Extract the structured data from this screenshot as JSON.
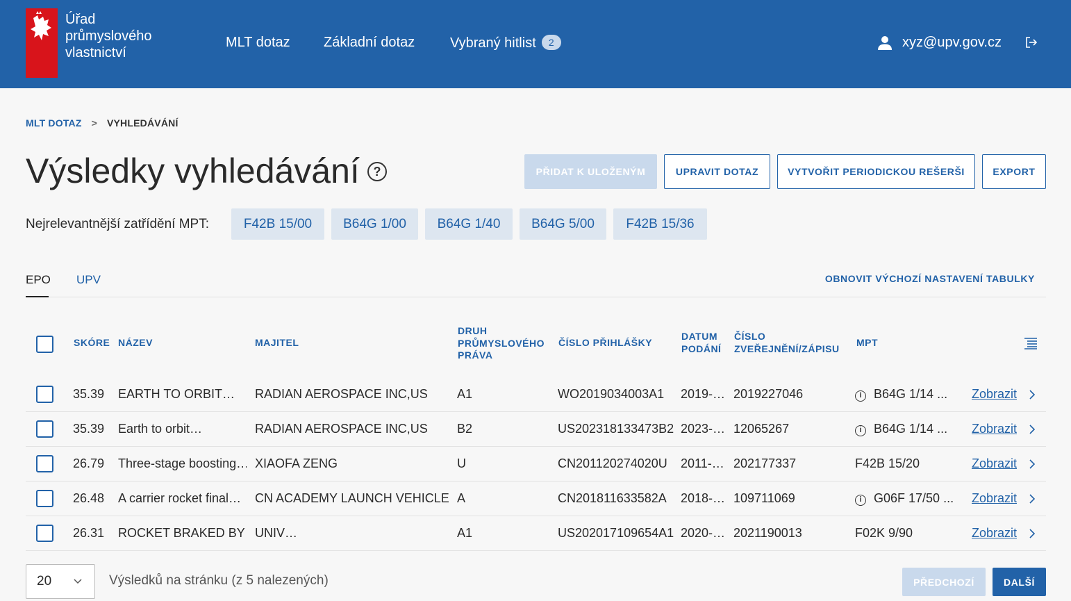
{
  "header": {
    "logo_lines": [
      "Úřad",
      "průmyslového",
      "vlastnictví"
    ],
    "nav": [
      {
        "label": "MLT dotaz"
      },
      {
        "label": "Základní dotaz"
      },
      {
        "label": "Vybraný hitlist",
        "badge": "2"
      }
    ],
    "user_email": "xyz@upv.gov.cz"
  },
  "breadcrumb": {
    "parent": "MLT DOTAZ",
    "separator": ">",
    "current": "VYHLEDÁVÁNÍ"
  },
  "page_title": "Výsledky vyhledávání",
  "help_symbol": "?",
  "actions": {
    "add_saved": "PŘIDAT K ULOŽENÝM",
    "edit_query": "UPRAVIT DOTAZ",
    "create_periodic": "VYTVOŘIT PERIODICKOU REŠERŠI",
    "export": "EXPORT"
  },
  "mpt": {
    "label": "Nejrelevantnější zatřídění MPT:",
    "chips": [
      "F42B 15/00",
      "B64G 1/00",
      "B64G 1/40",
      "B64G 5/00",
      "F42B 15/36"
    ]
  },
  "tabs": {
    "epo": "EPO",
    "upv": "UPV",
    "reset": "OBNOVIT VÝCHOZÍ NASTAVENÍ TABULKY"
  },
  "table": {
    "headers": {
      "score": "SKÓRE",
      "name": "NÁZEV",
      "owner": "MAJITEL",
      "right_type": [
        "DRUH",
        "PRŮMYSLOVÉHO",
        "PRÁVA"
      ],
      "app_number": "ČÍSLO PŘIHLÁŠKY",
      "filing_date": [
        "DATUM",
        "PODÁNÍ"
      ],
      "pub_number": [
        "ČÍSLO",
        "ZVEŘEJNĚNÍ/ZÁPISU"
      ],
      "mpt": "MPT"
    },
    "rows": [
      {
        "score": "35.39",
        "name": "EARTH TO ORBIT…",
        "owner": "RADIAN AEROSPACE INC,US",
        "type": "A1",
        "app": "WO2019034003A1",
        "date": "2019-…",
        "pub": "2019227046",
        "mpt": "B64G 1/14 ...",
        "info": true,
        "action": "Zobrazit"
      },
      {
        "score": "35.39",
        "name": "Earth to orbit…",
        "owner": "RADIAN AEROSPACE INC,US",
        "type": "B2",
        "app": "US202318133473B2",
        "date": "2023-…",
        "pub": "12065267",
        "mpt": "B64G 1/14 ...",
        "info": true,
        "action": "Zobrazit"
      },
      {
        "score": "26.79",
        "name": "Three-stage boosting…",
        "owner": "XIAOFA ZENG",
        "type": "U",
        "app": "CN201120274020U",
        "date": "2011-…",
        "pub": "202177337",
        "mpt": "F42B 15/20",
        "info": false,
        "action": "Zobrazit"
      },
      {
        "score": "26.48",
        "name": "A carrier rocket final…",
        "owner": "CN ACADEMY LAUNCH VEHICLE…",
        "type": "A",
        "app": "CN201811633582A",
        "date": "2018-…",
        "pub": "109711069",
        "mpt": "G06F 17/50 ...",
        "info": true,
        "action": "Zobrazit"
      },
      {
        "score": "26.31",
        "name": "ROCKET BRAKED BY…",
        "owner": "UNIV…",
        "type": "A1",
        "app": "US202017109654A1",
        "date": "2020-…",
        "pub": "2021190013",
        "mpt": "F02K 9/90",
        "info": false,
        "action": "Zobrazit"
      }
    ]
  },
  "pagination": {
    "per_page": "20",
    "summary": "Výsledků na stránku (z 5 nalezených)",
    "prev": "PŘEDCHOZÍ",
    "next": "DALŠÍ"
  },
  "colors": {
    "brand_blue": "#2262a8",
    "logo_red": "#d8141b",
    "chip_bg": "#dde6f0",
    "disabled_bg": "#c9d9ec"
  }
}
